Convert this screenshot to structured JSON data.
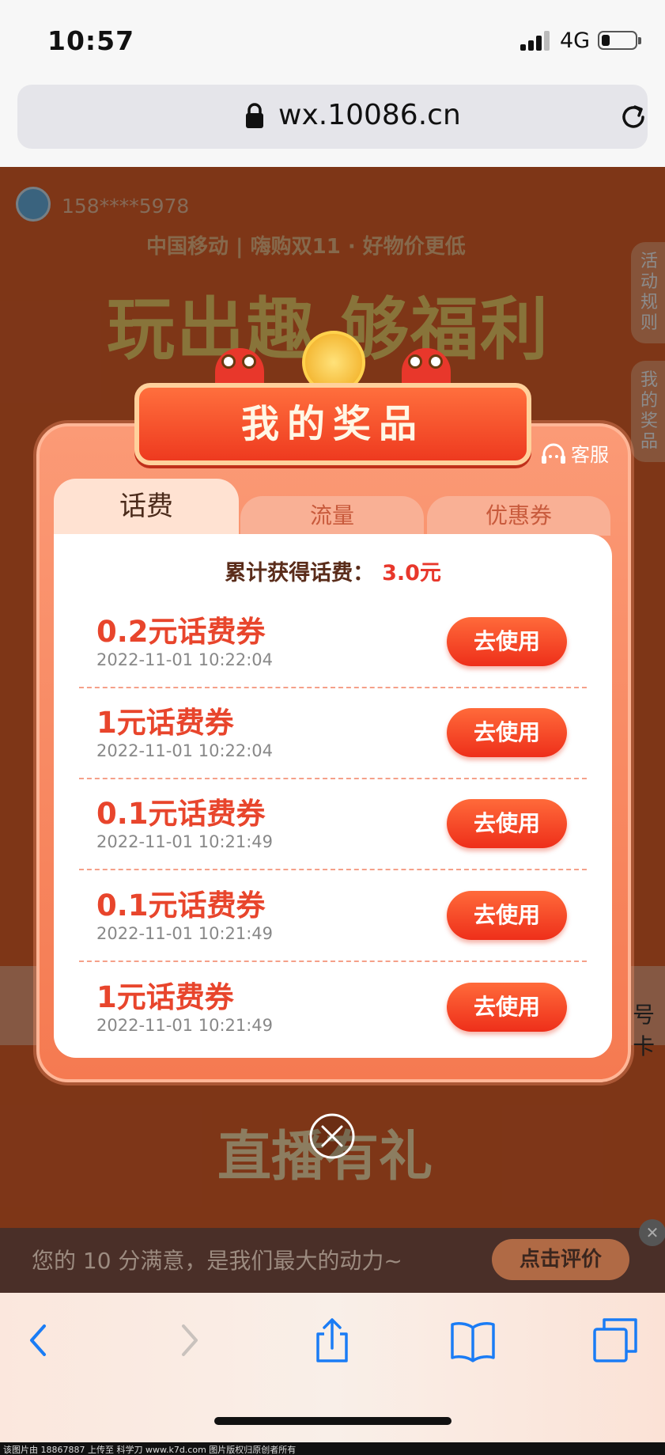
{
  "status_bar": {
    "time": "10:57",
    "network": "4G"
  },
  "browser": {
    "url": "wx.10086.cn"
  },
  "background": {
    "phone_masked": "158****5978",
    "brand_line": "中国移动 | 嗨购双11 · 好物价更低",
    "headline": "玩出趣 够福利",
    "side_tabs": [
      "活动规则",
      "我的奖品"
    ],
    "live_title": "直播有礼",
    "partial_right_text": "号卡"
  },
  "modal": {
    "title": "我的奖品",
    "service_label": "客服",
    "tabs": [
      {
        "label": "话费",
        "active": true
      },
      {
        "label": "流量",
        "active": false
      },
      {
        "label": "优惠券",
        "active": false
      }
    ],
    "total_label": "累计获得话费：",
    "total_value": "3.0元",
    "prizes": [
      {
        "name": "0.2元话费券",
        "time": "2022-11-01 10:22:04",
        "action": "去使用"
      },
      {
        "name": "1元话费券",
        "time": "2022-11-01 10:22:04",
        "action": "去使用"
      },
      {
        "name": "0.1元话费券",
        "time": "2022-11-01 10:21:49",
        "action": "去使用"
      },
      {
        "name": "0.1元话费券",
        "time": "2022-11-01 10:21:49",
        "action": "去使用"
      },
      {
        "name": "1元话费券",
        "time": "2022-11-01 10:21:49",
        "action": "去使用"
      }
    ]
  },
  "rating_bar": {
    "text": "您的 10 分满意，是我们最大的动力~",
    "button": "点击评价"
  },
  "footer": {
    "watermark": "该图片由 18867887 上传至 科学刀 www.k7d.com 图片版权归原创者所有"
  },
  "colors": {
    "accent": "#e8452c",
    "button": "#ee2f1a",
    "modal_bg": "#f57a51"
  }
}
